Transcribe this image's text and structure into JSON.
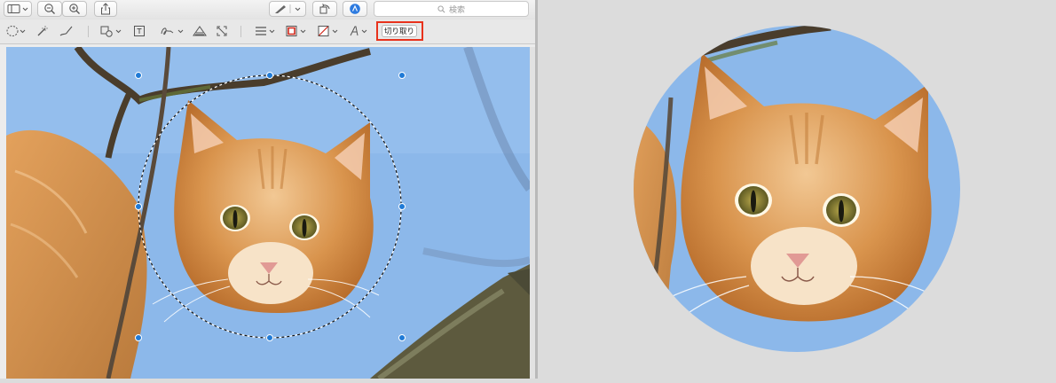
{
  "toolbar": {
    "search_placeholder": "検索",
    "crop_label": "切り取り"
  },
  "icons": {
    "sidebar": "sidebar-icon",
    "zoom_out": "zoom-out-icon",
    "zoom_in": "zoom-in-icon",
    "share": "share-icon",
    "pen": "pen-icon",
    "rotate": "rotate-icon",
    "markup": "markup-icon",
    "search": "search-icon",
    "selection": "ellipse-selection-icon",
    "instant_alpha": "magic-wand-icon",
    "sketch": "sketch-icon",
    "shapes": "shapes-icon",
    "text": "text-box-icon",
    "sign": "signature-icon",
    "adjust_color": "adjust-color-icon",
    "adjust_size": "adjust-size-icon",
    "line_style": "line-style-icon",
    "border_color": "border-color-icon",
    "fill_color": "fill-color-icon",
    "text_style": "text-style-icon"
  },
  "colors": {
    "crop_highlight": "#e8321c",
    "selection_handle": "#1f7ad6",
    "sky": "#8cb8ea",
    "fur": "#d99a55"
  }
}
